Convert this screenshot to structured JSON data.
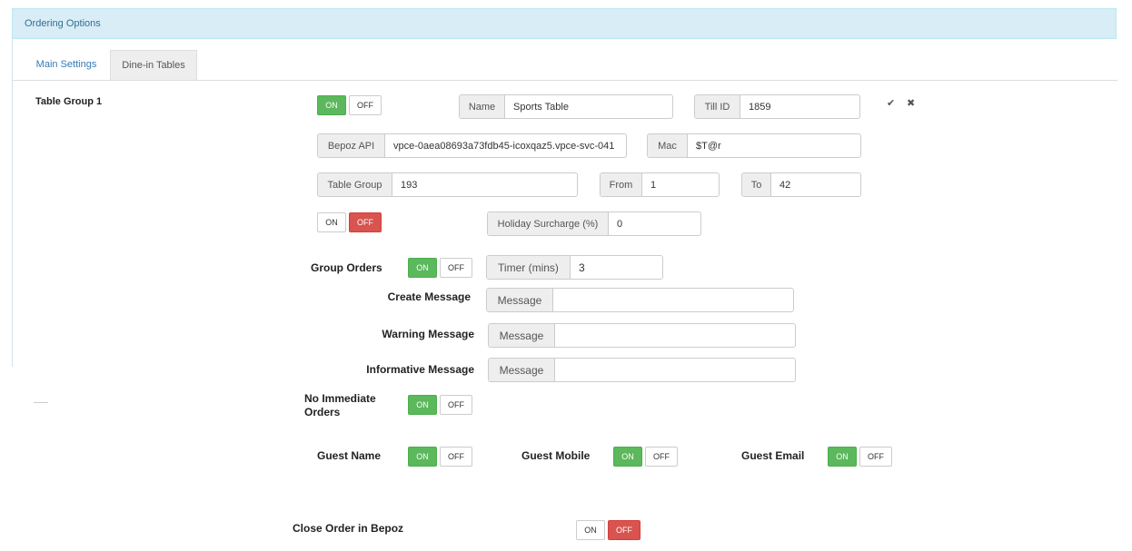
{
  "panel": {
    "title": "Ordering Options"
  },
  "tabs": [
    {
      "label": "Main Settings"
    },
    {
      "label": "Dine-in Tables"
    }
  ],
  "table_group": {
    "title": "Table Group 1",
    "enabled_toggle": {
      "on": "ON",
      "off": "OFF",
      "state": "on"
    },
    "name": {
      "label": "Name",
      "value": "Sports Table"
    },
    "till_id": {
      "label": "Till ID",
      "value": "1859"
    },
    "save_icon": "check-icon",
    "delete_icon": "close-icon",
    "bepoz_api": {
      "label": "Bepoz API",
      "value": "vpce-0aea08693a73fdb45-icoxqaz5.vpce-svc-041"
    },
    "mac": {
      "label": "Mac",
      "value": "$T@r"
    },
    "table_group_field": {
      "label": "Table Group",
      "value": "193"
    },
    "from": {
      "label": "From",
      "value": "1"
    },
    "to": {
      "label": "To",
      "value": "42"
    },
    "surcharge_toggle": {
      "on": "ON",
      "off": "OFF",
      "state": "off"
    },
    "holiday_surcharge": {
      "label": "Holiday Surcharge (%)",
      "value": "0"
    },
    "group_orders": {
      "label": "Group Orders",
      "on": "ON",
      "off": "OFF",
      "state": "on"
    },
    "timer": {
      "label": "Timer (mins)",
      "value": "3"
    },
    "create_message": {
      "label": "Create Message",
      "addon": "Message",
      "value": ""
    },
    "warning_message": {
      "label": "Warning Message",
      "addon": "Message",
      "value": ""
    },
    "informative_message": {
      "label": "Informative Message",
      "addon": "Message",
      "value": ""
    },
    "no_immediate_orders": {
      "label_line1": "No Immediate",
      "label_line2": "Orders",
      "on": "ON",
      "off": "OFF",
      "state": "on"
    },
    "guest_name": {
      "label": "Guest Name",
      "on": "ON",
      "off": "OFF",
      "state": "on"
    },
    "guest_mobile": {
      "label": "Guest Mobile",
      "on": "ON",
      "off": "OFF",
      "state": "on"
    },
    "guest_email": {
      "label": "Guest Email",
      "on": "ON",
      "off": "OFF",
      "state": "on"
    },
    "close_order": {
      "label": "Close Order in Bepoz",
      "on": "ON",
      "off": "OFF",
      "state": "off"
    }
  },
  "colors": {
    "on_active": "#5cb85c",
    "off_active": "#d9534f",
    "header_bg": "#d9edf7",
    "link": "#337ab7"
  }
}
